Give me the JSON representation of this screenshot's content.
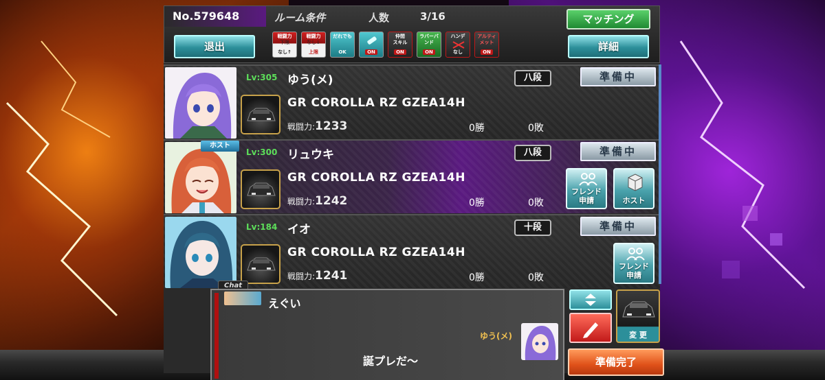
{
  "header": {
    "room_no": "No.579648",
    "condition_label": "ルーム条件",
    "count_label": "人数",
    "count_value": "3/16",
    "matching_button": "マッチング",
    "exit_button": "退出",
    "detail_button": "詳細"
  },
  "conditions": [
    {
      "top": "戦闘力",
      "mid": "下限",
      "bot": "なし↑",
      "icon": "power-lower-limit-icon"
    },
    {
      "top": "戦闘力",
      "mid": "なし↓",
      "bot": "上限",
      "icon": "power-upper-limit-icon"
    },
    {
      "top": "だれでも",
      "mid": "",
      "bot": "OK",
      "icon": "anyone-ok-icon"
    },
    {
      "top": "",
      "mid": "",
      "bot": "ON",
      "icon": "nitro-icon"
    },
    {
      "top": "仲間",
      "mid": "スキル",
      "bot": "ON",
      "icon": "team-skill-icon"
    },
    {
      "top": "ラバーバンド",
      "mid": "",
      "bot": "ON",
      "icon": "rubber-band-icon"
    },
    {
      "top": "ハンデ",
      "mid": "",
      "bot": "なし",
      "icon": "handicap-icon"
    },
    {
      "top": "アルティ",
      "mid": "メット",
      "bot": "ON",
      "icon": "ultimate-icon"
    }
  ],
  "players": [
    {
      "level": "Lv:305",
      "name": "ゆう(メ)",
      "rank": "八段",
      "status": "準備中",
      "car": "GR COROLLA RZ GZEA14H",
      "power_label": "戦闘力:",
      "power": "1233",
      "wins": "0勝",
      "losses": "0敗",
      "host": false
    },
    {
      "level": "Lv:300",
      "name": "リュウキ",
      "rank": "八段",
      "status": "準備中",
      "car": "GR COROLLA RZ GZEA14H",
      "power_label": "戦闘力:",
      "power": "1242",
      "wins": "0勝",
      "losses": "0敗",
      "host": true,
      "host_tag": "ホスト"
    },
    {
      "level": "Lv:184",
      "name": "イオ",
      "rank": "十段",
      "status": "準備中",
      "car": "GR COROLLA RZ GZEA14H",
      "power_label": "戦闘力:",
      "power": "1241",
      "wins": "0勝",
      "losses": "0敗",
      "host": false
    }
  ],
  "actions": {
    "friend_request": "フレンド\n申請",
    "host": "ホスト"
  },
  "chat": {
    "tab": "Chat",
    "message1": "えぐい",
    "sender2": "ゆう(メ)",
    "message2": "誕プレだ〜"
  },
  "controls": {
    "change_label": "変 更",
    "ready_button": "準備完了"
  },
  "colors": {
    "ready_accent": "#e0521a",
    "match_green": "#1f8a32",
    "teal": "#2c8f9a",
    "level_green": "#5ddf5a"
  }
}
